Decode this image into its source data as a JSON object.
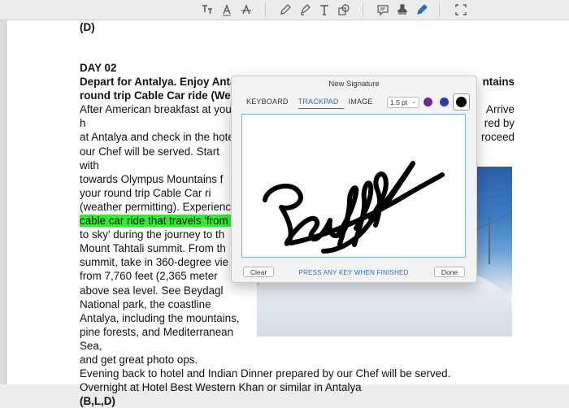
{
  "toolbar": {
    "icons": [
      "text-box-icon",
      "text-style-icon",
      "strikethrough-icon",
      "pen-icon",
      "highlighter-icon",
      "text-icon",
      "shapes-icon",
      "comment-icon",
      "stamp-icon",
      "signature-pen-icon",
      "crop-icon"
    ]
  },
  "document": {
    "top_line": "(D)",
    "day": "DAY 02",
    "heading": [
      "Depart for Antalya. Enjoy Antaly",
      "ntains",
      "round trip Cable Car ride (Weather"
    ],
    "left_lines": [
      " After American breakfast at your h",
      "at Antalya and check in the hotel",
      "our Chef will be served. Start with",
      "towards  Olympus  Mountains  f",
      "your  round  trip  Cable  Car  ri",
      "(weather  permitting).  Experience",
      "cable car ride that travels 'from s",
      "to  sky'  during  the  journey  to  th",
      "Mount  Tahtali  summit.  From  th",
      "summit,  take  in  360-degree  vie",
      "from  7,760  feet  (2,365  meter",
      "above  sea  level.  See  Beydagl",
      "National  park,  the  coastline",
      "Antalya,  including  the  mountains,",
      "pine forests, and Mediterranean Sea,",
      "and get great photo ops."
    ],
    "right_fragments": [
      "Arrive",
      "red by",
      "roceed"
    ],
    "bottom_lines": [
      "Evening back to hotel and Indian Dinner prepared by our Chef will be served.",
      "Overnight at Hotel Best Western Khan or similar in Antalya"
    ],
    "meals": "(B,L,D)"
  },
  "dialog": {
    "title": "New Signature",
    "tabs": [
      "KEYBOARD",
      "TRACKPAD",
      "IMAGE"
    ],
    "active_tab": "TRACKPAD",
    "stroke_size": "1.5 pt",
    "colors": [
      "#6a2a8c",
      "#2a3f9c",
      "#000000"
    ],
    "selected_color": "#000000",
    "clear_label": "Clear",
    "hint": "PRESS ANY KEY WHEN FINISHED",
    "done_label": "Done"
  },
  "colors": {
    "highlight": "#39e639",
    "accent": "#2f6fb3"
  }
}
